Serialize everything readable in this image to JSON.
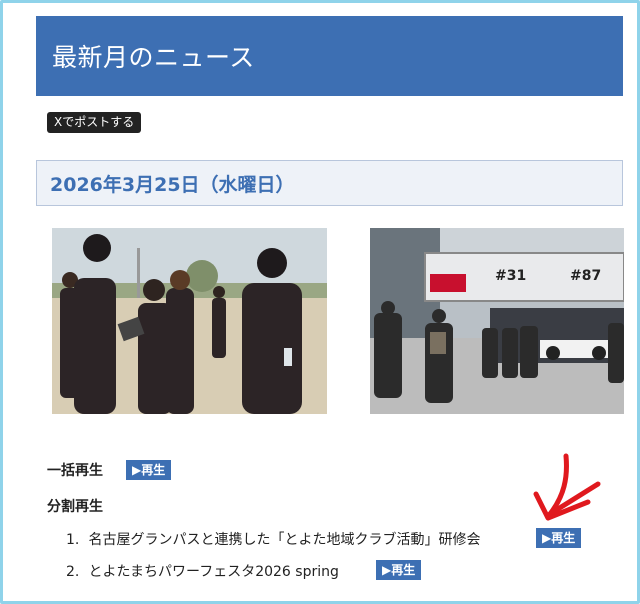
{
  "header": {
    "title": "最新月のニュース"
  },
  "share": {
    "label": "Xでポストする"
  },
  "article": {
    "date": "2026年3月25日（水曜日）"
  },
  "playback": {
    "play_all_label": "一括再生",
    "split_label": "分割再生",
    "play_badge": "▶再生",
    "items": [
      {
        "number": "1.",
        "title": "名古屋グランパスと連携した「とよた地域クラブ活動」研修会"
      },
      {
        "number": "2.",
        "title": "とよたまちパワーフェスタ2026 spring"
      }
    ]
  },
  "photo2_banner": {
    "num1": "#31",
    "num2": "#87"
  },
  "colors": {
    "accent": "#3d6fb3",
    "frame": "#8fd3ea",
    "annotation": "#e0191e"
  }
}
